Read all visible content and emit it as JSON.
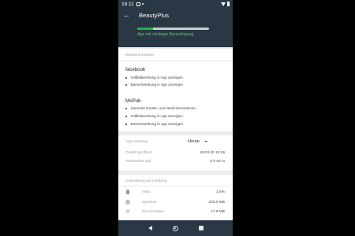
{
  "status_bar": {
    "time": "16:11"
  },
  "header": {
    "title": "BeautyPlus",
    "progress": 0.22,
    "status": "App mit niedriger Berechtigung"
  },
  "networks": {
    "title": "Werbenetzwerke",
    "items": [
      {
        "name": "facebook",
        "bullets": [
          "Vollbildwerbung in App anzeigen",
          "Bannerwerbung in App anzeigen"
        ]
      },
      {
        "name": "MoPub",
        "bullets": [
          "Sammelt Geräte- und Netzinformationen",
          "Vollbildwerbung in App anzeigen",
          "Bannerwerbung in App anzeigen"
        ]
      }
    ]
  },
  "usage": {
    "label": "App-Nutzung",
    "selected": "Heute",
    "rows": [
      {
        "label": "Zuletzt geöffnet",
        "value": "16.03.20 15:46"
      },
      {
        "label": "Verbrachte Zeit",
        "value": "0 h 02 m"
      }
    ]
  },
  "impact": {
    "title": "Auswirkung auf Leistung",
    "rows": [
      {
        "icon": "battery-icon",
        "label": "Akku",
        "value": "1.5%"
      },
      {
        "icon": "storage-icon",
        "label": "Speicher",
        "value": "203.0 MB"
      },
      {
        "icon": "wifi-icon",
        "label": "WLAN-Daten",
        "value": "17.9 MB"
      }
    ]
  }
}
